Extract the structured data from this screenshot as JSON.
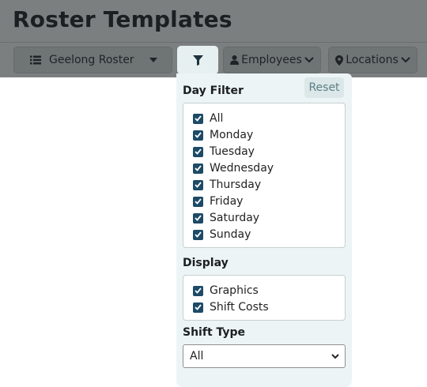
{
  "header": {
    "title": "Roster Templates"
  },
  "toolbar": {
    "roster_label": "Geelong Roster",
    "employees_label": "Employees",
    "locations_label": "Locations"
  },
  "filter_panel": {
    "day_filter": {
      "title": "Day Filter",
      "reset_label": "Reset",
      "options": [
        {
          "label": "All",
          "checked": true
        },
        {
          "label": "Monday",
          "checked": true
        },
        {
          "label": "Tuesday",
          "checked": true
        },
        {
          "label": "Wednesday",
          "checked": true
        },
        {
          "label": "Thursday",
          "checked": true
        },
        {
          "label": "Friday",
          "checked": true
        },
        {
          "label": "Saturday",
          "checked": true
        },
        {
          "label": "Sunday",
          "checked": true
        }
      ]
    },
    "display": {
      "title": "Display",
      "options": [
        {
          "label": "Graphics",
          "checked": true
        },
        {
          "label": "Shift Costs",
          "checked": true
        }
      ]
    },
    "shift_type": {
      "title": "Shift Type",
      "selected": "All"
    }
  },
  "colors": {
    "overlay": "#7c7f80",
    "panel_bg": "#edf4f5",
    "checkbox": "#1d4a66"
  },
  "icons": [
    "list-icon",
    "caret-down-icon",
    "filter-icon",
    "user-icon",
    "chevron-down-icon",
    "map-marker-icon",
    "check-icon"
  ]
}
